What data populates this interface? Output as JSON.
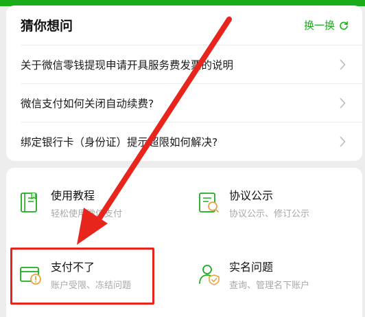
{
  "faq": {
    "title": "猜你想问",
    "refresh_label": "换一换",
    "items": [
      {
        "question": "关于微信零钱提现申请开具服务费发票的说明"
      },
      {
        "question": "微信支付如何关闭自动续费?"
      },
      {
        "question": "绑定银行卡（身份证）提示超限如何解决?"
      }
    ]
  },
  "services": [
    {
      "title": "使用教程",
      "subtitle": "轻松使用微信支付",
      "icon": "tutorial-book-icon"
    },
    {
      "title": "协议公示",
      "subtitle": "协议公示、修订公示",
      "icon": "agreement-search-icon"
    },
    {
      "title": "支付不了",
      "subtitle": "账户受限、冻结问题",
      "icon": "card-warning-icon"
    },
    {
      "title": "实名问题",
      "subtitle": "查询、管理名下账户",
      "icon": "user-shield-icon"
    }
  ],
  "colors": {
    "brand_green": "#1aad19",
    "annotation_red": "#e8251c"
  }
}
